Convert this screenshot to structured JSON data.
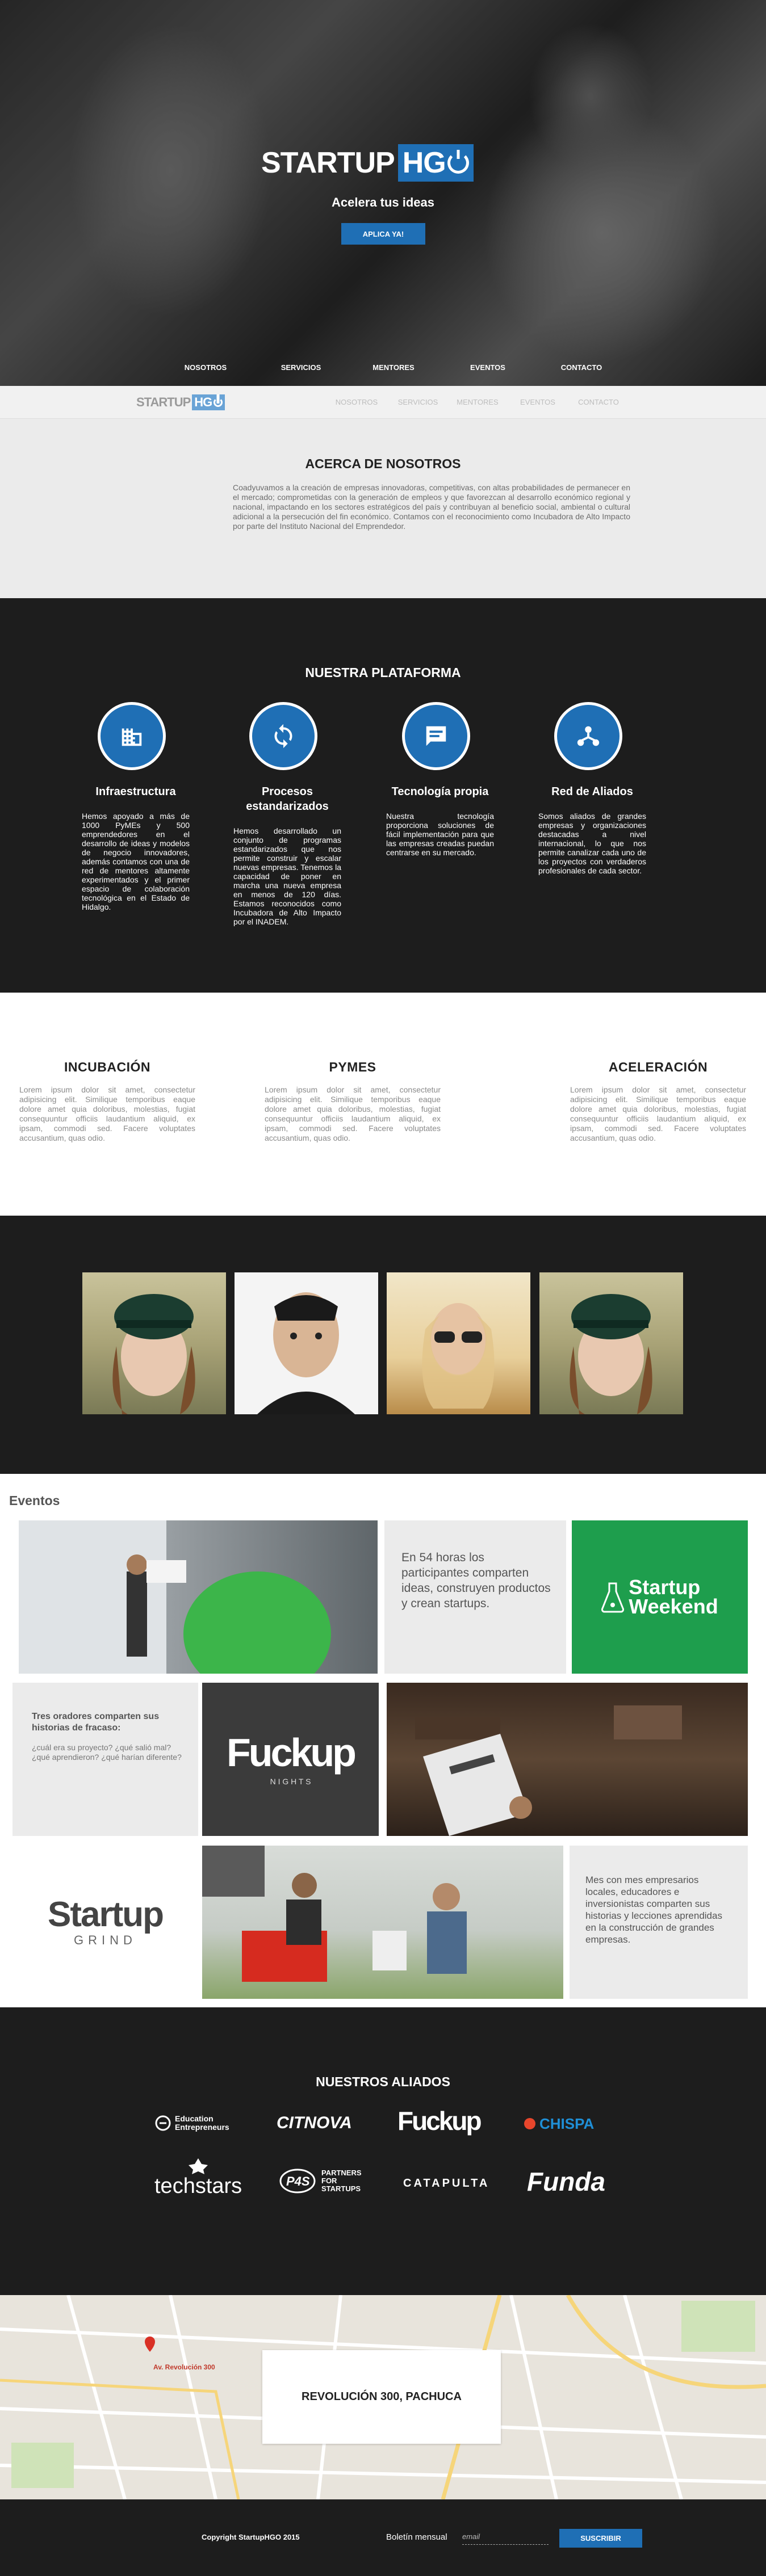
{
  "brand": {
    "word": "STARTUP",
    "box": "HG"
  },
  "hero": {
    "tagline": "Acelera tus ideas",
    "cta": "APLICA YA!"
  },
  "nav": [
    "NOSOTROS",
    "SERVICIOS",
    "MENTORES",
    "EVENTOS",
    "CONTACTO"
  ],
  "about": {
    "title": "ACERCA DE NOSOTROS",
    "text": "Coadyuvamos a la creación de empresas innovadoras, competitivas, con altas probabilidades de permanecer en el mercado; comprometidas con la generación de empleos y que favorezcan al desarrollo económico regional y nacional, impactando en los sectores estratégicos del país y contribuyan al beneficio social, ambiental o cultural adicional a la persecución del fin económico. Contamos con el reconocimiento como Incubadora de Alto Impacto por parte del Instituto Nacional del Emprendedor."
  },
  "platform": {
    "title": "NUESTRA PLATAFORMA",
    "features": [
      {
        "icon": "building-icon",
        "title": "Infraestructura",
        "text": "Hemos apoyado a más de 1000 PyMEs y 500 emprendedores en el desarrollo de ideas y modelos de negocio innovadores, además contamos con una de red de mentores altamente experimentados y el primer espacio de colaboración tecnológica en el Estado de Hidalgo."
      },
      {
        "icon": "sync-icon",
        "title": "Procesos estandarizados",
        "text": "Hemos desarrollado un conjunto de programas estandarizados que nos permite construir y escalar nuevas empresas. Tenemos la capacidad de poner en marcha una nueva empresa en menos de 120 días. Estamos reconocidos como Incubadora de Alto Impacto por el INADEM."
      },
      {
        "icon": "message-icon",
        "title": "Tecnología propia",
        "text": "Nuestra tecnología proporciona soluciones de fácil implementación para que las empresas creadas puedan centrarse en su mercado."
      },
      {
        "icon": "network-icon",
        "title": "Red de Aliados",
        "text": "Somos aliados de grandes empresas y organizaciones destacadas a nivel internacional, lo que nos permite canalizar cada uno de los proyectos con verdaderos profesionales de cada sector."
      }
    ]
  },
  "programs": [
    {
      "title": "INCUBACIÓN",
      "text": "Lorem ipsum dolor sit amet, consectetur adipisicing elit. Similique temporibus eaque dolore amet quia doloribus, molestias, fugiat consequuntur officiis laudantium aliquid, ex ipsam, commodi sed. Facere voluptates accusantium, quas odio."
    },
    {
      "title": "PYMES",
      "text": "Lorem ipsum dolor sit amet, consectetur adipisicing elit. Similique temporibus eaque dolore amet quia doloribus, molestias, fugiat consequuntur officiis laudantium aliquid, ex ipsam, commodi sed. Facere voluptates accusantium, quas odio."
    },
    {
      "title": "ACELERACIÓN",
      "text": "Lorem ipsum dolor sit amet, consectetur adipisicing elit. Similique temporibus eaque dolore amet quia doloribus, molestias, fugiat consequuntur officiis laudantium aliquid, ex ipsam, commodi sed. Facere voluptates accusantium, quas odio."
    }
  ],
  "events": {
    "title": "Eventos",
    "sw_text": "En 54 horas los participantes comparten ideas, construyen productos y crean startups.",
    "sw_logo_1": "Startup",
    "sw_logo_2": "Weekend",
    "fu_title": "Tres oradores comparten sus historias de fracaso:",
    "fu_questions": "¿cuál era su proyecto? ¿qué salió mal? ¿qué aprendieron? ¿qué harían diferente?",
    "fu_logo": "Fuckup",
    "fu_sub": "N I G H T S",
    "sg_logo_1": "Startup",
    "sg_logo_2": "GRIND",
    "sg_text": "Mes con mes empresarios locales, educadores e inversionistas comparten sus historias y lecciones aprendidas en la construcción de grandes empresas."
  },
  "allies": {
    "title": "NUESTROS ALIADOS",
    "logos": [
      "Education Entrepreneurs",
      "CITNOVA",
      "Fuckup",
      "CHISPA",
      "techstars",
      "PARTNERS FOR STARTUPS",
      "CATAPULTA",
      "Funda"
    ]
  },
  "map": {
    "address": "REVOLUCIÓN 300, PACHUCA",
    "pin_label": "Av. Revolución 300"
  },
  "footer": {
    "copyright": "Copyright StartupHGO 2015",
    "newsletter": "Boletín mensual",
    "email_placeholder": "email",
    "subscribe": "SUSCRIBIR"
  },
  "colors": {
    "accent": "#1f6fb5",
    "dark": "#1d1d1d",
    "light": "#ebebeb",
    "sw_green": "#1e9e4d",
    "sg_red": "#d92b2b"
  }
}
